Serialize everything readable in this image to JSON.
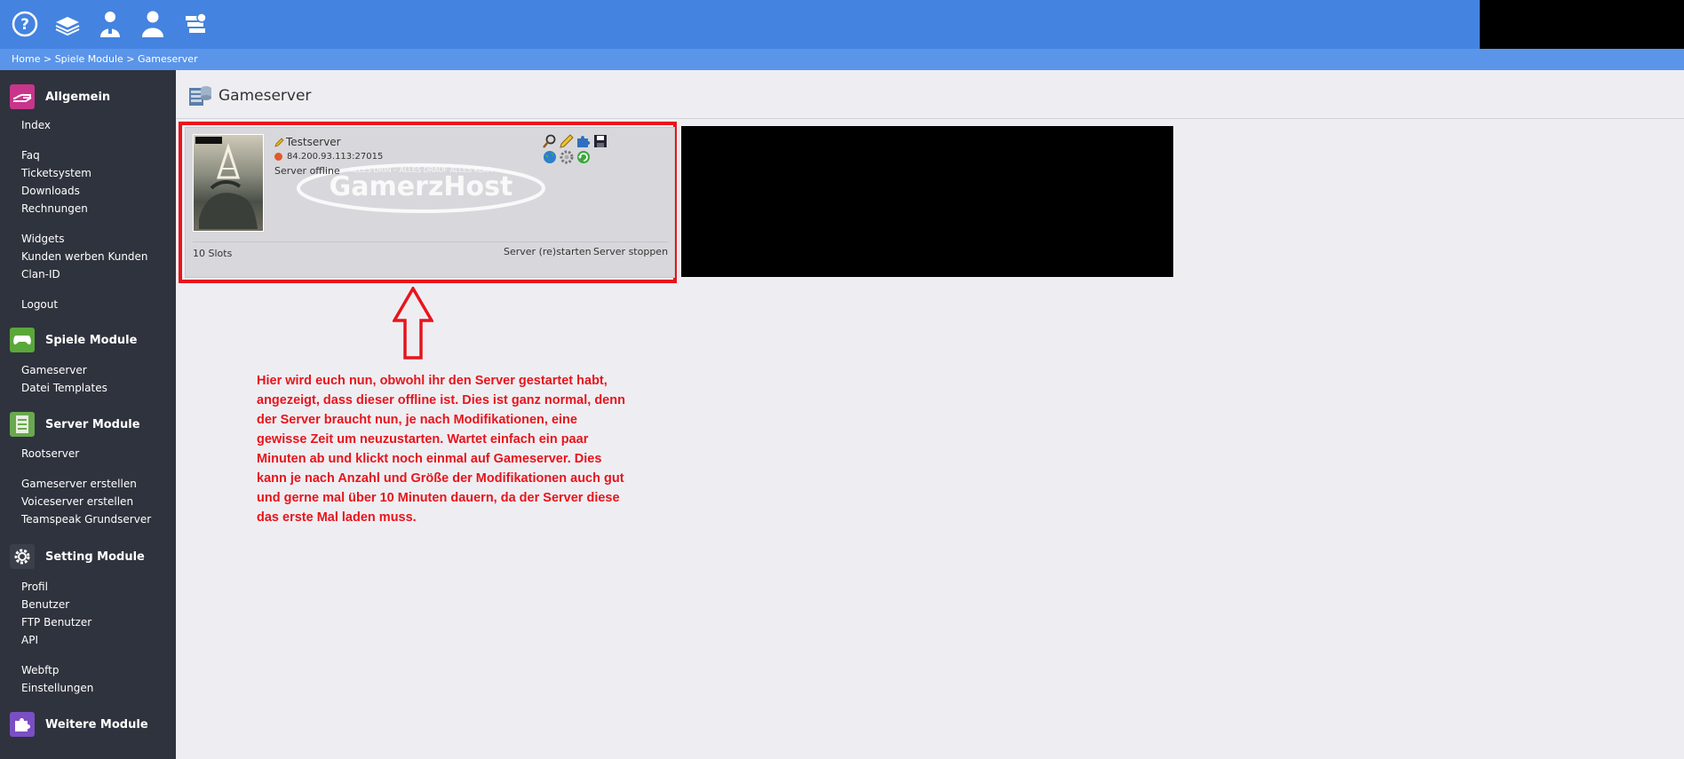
{
  "breadcrumb": {
    "home": "Home",
    "sep": " > ",
    "section": "Spiele Module",
    "page": "Gameserver"
  },
  "topbar_icons": [
    "help-icon",
    "book-icon",
    "admin-icon",
    "user-icon",
    "money-icon"
  ],
  "sidebar": {
    "allgemein": {
      "title": "Allgemein",
      "items": [
        "Index",
        "Faq",
        "Ticketsystem",
        "Downloads",
        "Rechnungen",
        "Widgets",
        "Kunden werben Kunden",
        "Clan-ID",
        "Logout"
      ]
    },
    "spiele": {
      "title": "Spiele Module",
      "items": [
        "Gameserver",
        "Datei Templates"
      ]
    },
    "server": {
      "title": "Server Module",
      "items": [
        "Rootserver",
        "Gameserver erstellen",
        "Voiceserver erstellen",
        "Teamspeak Grundserver"
      ]
    },
    "setting": {
      "title": "Setting Module",
      "items": [
        "Profil",
        "Benutzer",
        "FTP Benutzer",
        "API",
        "Webftp",
        "Einstellungen"
      ]
    },
    "weitere": {
      "title": "Weitere Module"
    }
  },
  "page_title": "Gameserver",
  "server": {
    "name": "Testserver",
    "address": "84.200.93.113:27015",
    "status": "Server offline",
    "slots": "10 Slots",
    "restart_label": "Server (re)starten",
    "stop_label": "Server stoppen",
    "watermark": "GamerzHost",
    "watermark_tagline": "ALLES DRIN – ALLES DRAUF  ALLES KLAR"
  },
  "note": "Hier wird euch nun, obwohl ihr den Server gestartet habt, angezeigt, dass dieser offline ist. Dies ist ganz normal, denn der Server braucht nun, je nach Modifikationen, eine gewisse Zeit um neuzustarten. Wartet einfach ein paar Minuten ab und klickt noch einmal auf Gameserver. Dies kann je nach Anzahl und Größe der Modifikationen auch gut und gerne mal über 10 Minuten dauern, da der Server diese das erste Mal laden muss.",
  "colors": {
    "topbar": "#4483e0",
    "breadcrumb": "#5a95ea",
    "sidebar": "#2f333d",
    "annotation": "#e8141c",
    "status_dot": "#e05a2a"
  }
}
